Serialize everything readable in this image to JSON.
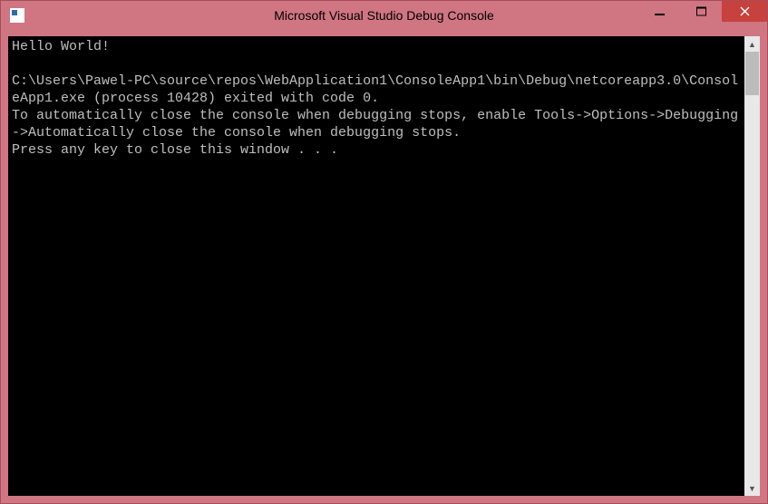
{
  "window": {
    "title": "Microsoft Visual Studio Debug Console"
  },
  "console": {
    "lines": [
      "Hello World!",
      "",
      "C:\\Users\\Pawel-PC\\source\\repos\\WebApplication1\\ConsoleApp1\\bin\\Debug\\netcoreapp3.0\\ConsoleApp1.exe (process 10428) exited with code 0.",
      "To automatically close the console when debugging stops, enable Tools->Options->Debugging->Automatically close the console when debugging stops.",
      "Press any key to close this window . . ."
    ]
  }
}
